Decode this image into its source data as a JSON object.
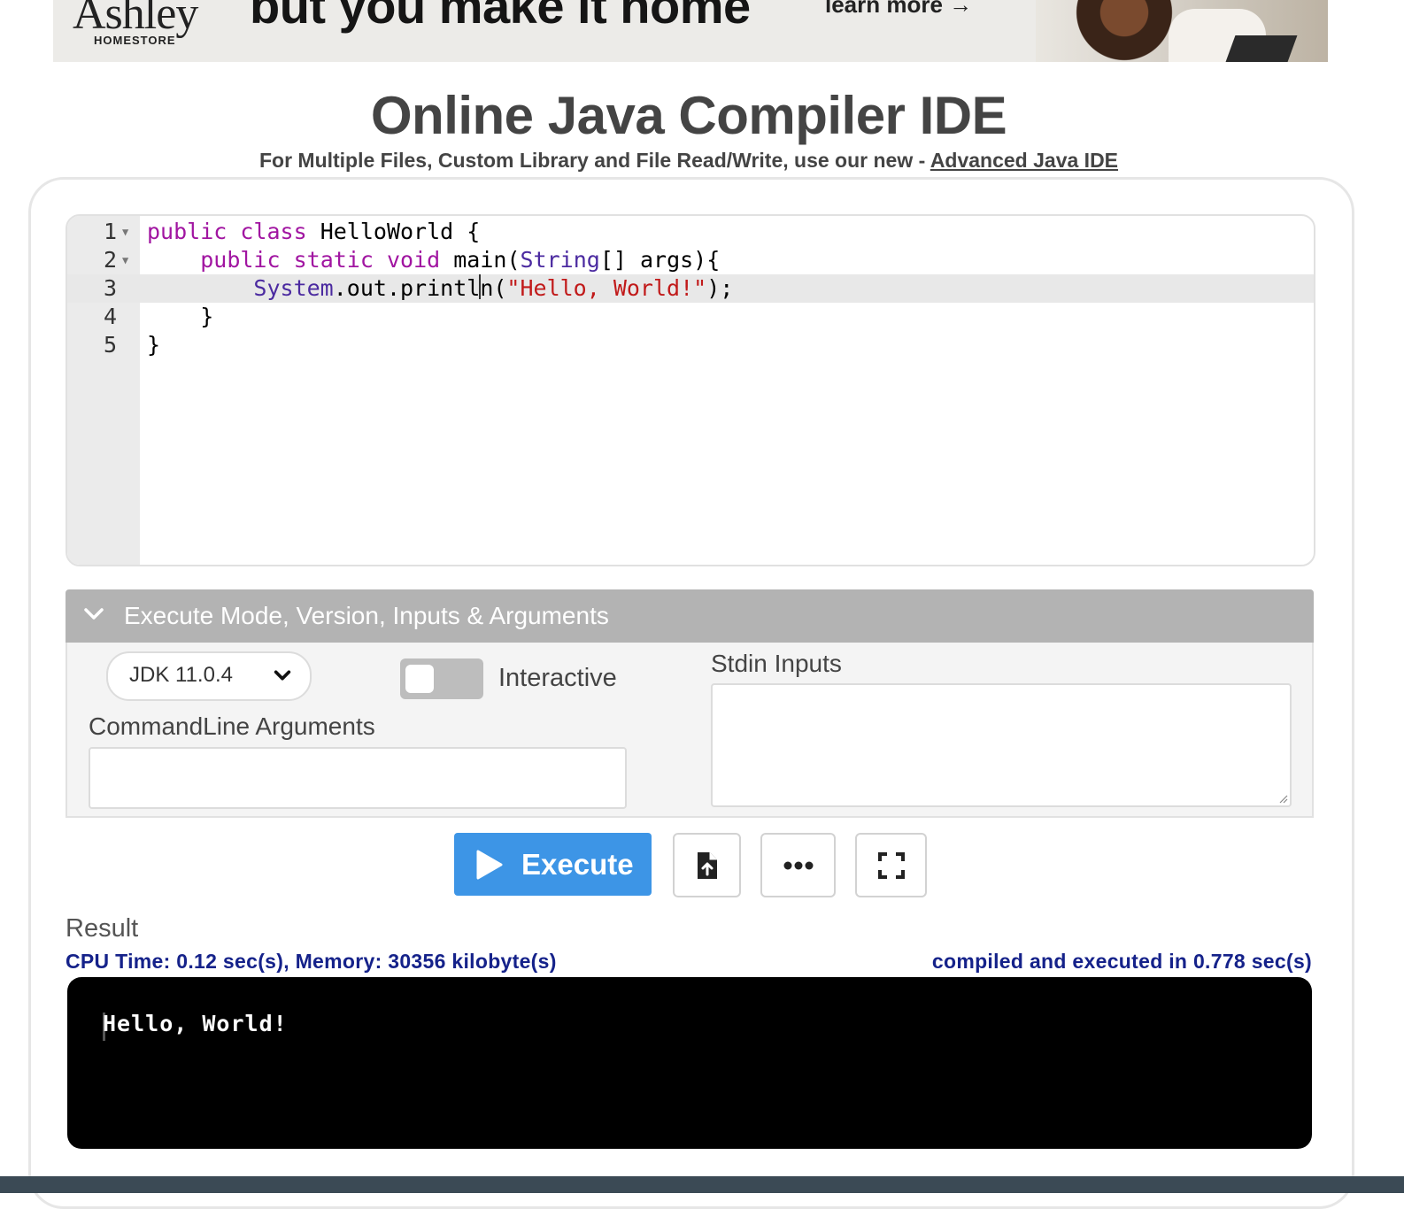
{
  "ad": {
    "brand": "Ashley",
    "brand_sub": "HOMESTORE",
    "headline": "but you make it home",
    "cta": "learn more →"
  },
  "header": {
    "title": "Online Java Compiler IDE",
    "subtitle_prefix": "For Multiple Files, Custom Library and File Read/Write, use our new - ",
    "subtitle_link": "Advanced Java IDE"
  },
  "editor": {
    "line_numbers": [
      "1",
      "2",
      "3",
      "4",
      "5"
    ],
    "active_line": 3,
    "lines": [
      "public class HelloWorld {",
      "    public static void main(String[] args){",
      "        System.out.println(\"Hello, World!\");",
      "    }",
      "}"
    ]
  },
  "options": {
    "section_title": "Execute Mode, Version, Inputs & Arguments",
    "jdk_version": "JDK 11.0.4",
    "interactive_label": "Interactive",
    "interactive_on": false,
    "cmdline_label": "CommandLine Arguments",
    "cmdline_value": "",
    "stdin_label": "Stdin Inputs",
    "stdin_value": ""
  },
  "actions": {
    "execute_label": "Execute",
    "upload_icon": "file-upload-icon",
    "more_icon": "ellipsis-icon",
    "fullscreen_icon": "fullscreen-icon"
  },
  "result": {
    "label": "Result",
    "stats": "CPU Time: 0.12 sec(s), Memory: 30356 kilobyte(s)",
    "compiled": "compiled and executed in 0.778 sec(s)",
    "output": "Hello, World!"
  },
  "colors": {
    "accent": "#3d95e6",
    "stats_text": "#15228a",
    "keyword": "#a115a1",
    "type": "#4b2aa0",
    "string": "#c11a1a"
  }
}
